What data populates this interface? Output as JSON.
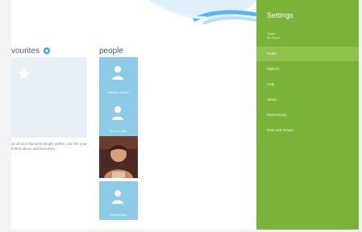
{
  "favourites": {
    "title": "vourites",
    "text": "op all your favourite people gether. Use the your button above add favourites"
  },
  "people": {
    "title": "people",
    "contacts": [
      {
        "name": "Rebeca Tanner"
      },
      {
        "name": "Kevin Kailey"
      },
      {
        "name": ""
      },
      {
        "name": "Dennis Mark"
      }
    ]
  },
  "settings": {
    "title": "Settings",
    "sub_line1": "Skype",
    "sub_line2": "By Skype",
    "items": [
      {
        "label": "Profile",
        "active": true
      },
      {
        "label": "Options",
        "active": false
      },
      {
        "label": "Help",
        "active": false
      },
      {
        "label": "About",
        "active": false
      },
      {
        "label": "Permissions",
        "active": false
      },
      {
        "label": "Rate and review",
        "active": false
      }
    ]
  }
}
